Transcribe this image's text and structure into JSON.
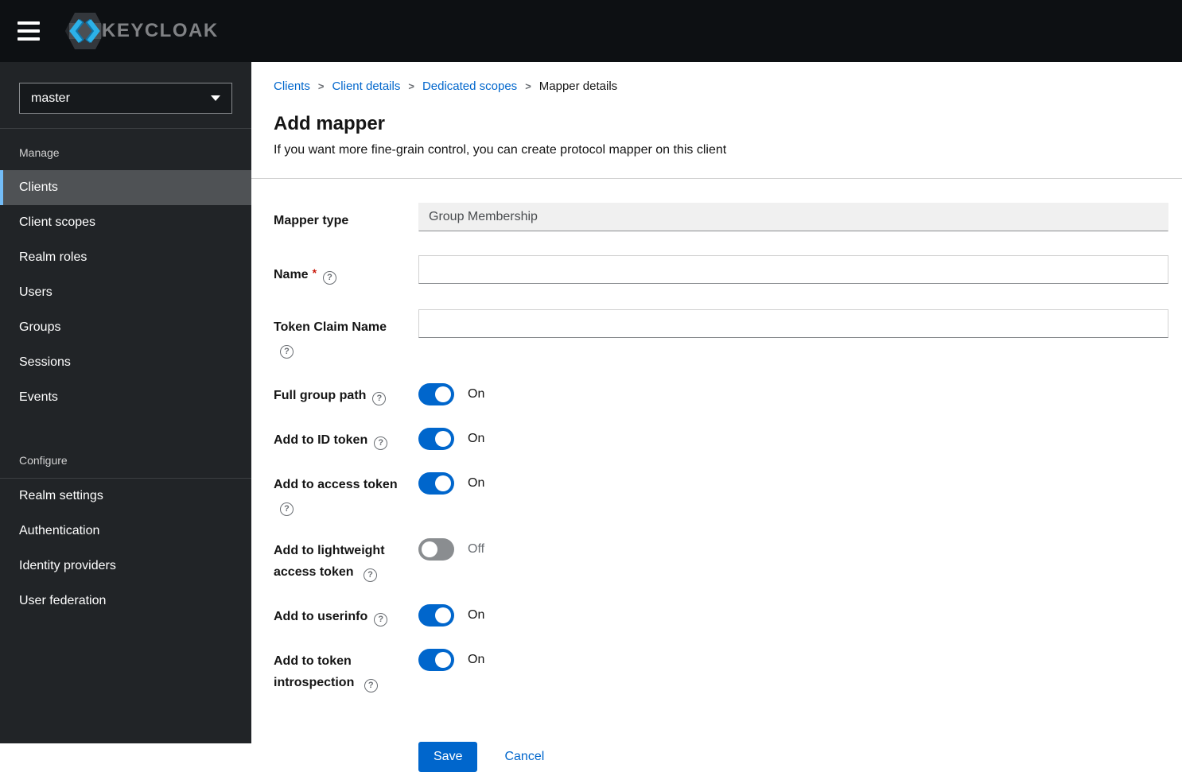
{
  "masthead": {
    "logo_text": "KEYCLOAK"
  },
  "sidebar": {
    "realm": "master",
    "groups": [
      {
        "label": "Manage",
        "items": [
          {
            "label": "Clients",
            "selected": true
          },
          {
            "label": "Client scopes"
          },
          {
            "label": "Realm roles"
          },
          {
            "label": "Users"
          },
          {
            "label": "Groups"
          },
          {
            "label": "Sessions"
          },
          {
            "label": "Events"
          }
        ]
      },
      {
        "label": "Configure",
        "items": [
          {
            "label": "Realm settings"
          },
          {
            "label": "Authentication"
          },
          {
            "label": "Identity providers"
          },
          {
            "label": "User federation"
          }
        ]
      }
    ]
  },
  "breadcrumb": {
    "items": [
      {
        "label": "Clients",
        "link": true
      },
      {
        "label": "Client details",
        "link": true
      },
      {
        "label": "Dedicated scopes",
        "link": true
      },
      {
        "label": "Mapper details",
        "current": true
      }
    ]
  },
  "page": {
    "title": "Add mapper",
    "subtitle": "If you want more fine-grain control, you can create protocol mapper on this client"
  },
  "form": {
    "mapper_type": {
      "label": "Mapper type",
      "value": "Group Membership",
      "disabled": true
    },
    "name": {
      "label": "Name",
      "value": "",
      "required": true
    },
    "token_claim_name": {
      "label": "Token Claim Name",
      "value": ""
    },
    "toggles": [
      {
        "label": "Full group path",
        "state": "On"
      },
      {
        "label": "Add to ID token",
        "state": "On"
      },
      {
        "label": "Add to access token",
        "state": "On"
      },
      {
        "label": "Add to lightweight access token",
        "state": "Off"
      },
      {
        "label": "Add to userinfo",
        "state": "On"
      },
      {
        "label": "Add to token introspection",
        "state": "On"
      }
    ],
    "actions": {
      "save": "Save",
      "cancel": "Cancel"
    }
  },
  "icons": {
    "help": "?",
    "required_marker": "*",
    "breadcrumb_separator": ">"
  },
  "colors": {
    "primary": "#0066cc",
    "link": "#0066cc",
    "toggle_on": "#0066cc",
    "toggle_off": "#8a8d90",
    "nav_selected_bg": "#4f5255",
    "nav_selected_indicator": "#73bcf7",
    "masthead_bg": "#0d1013",
    "sidebar_bg": "#212427",
    "danger": "#c9190b"
  }
}
